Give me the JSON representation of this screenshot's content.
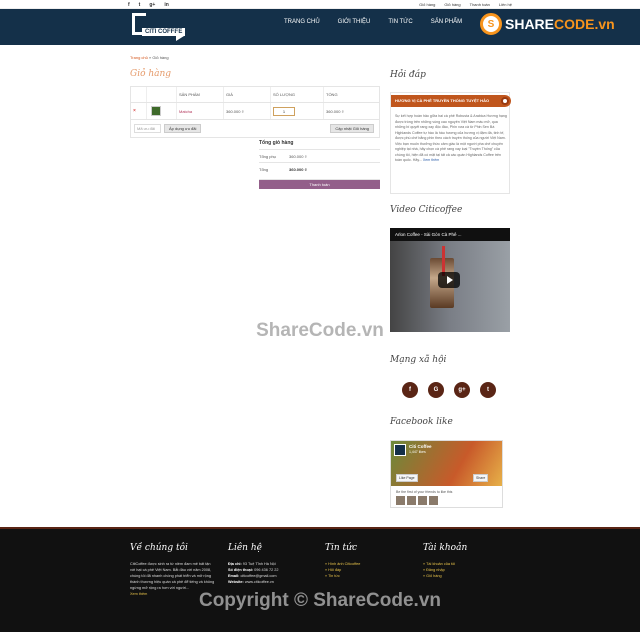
{
  "topbar": {
    "social": [
      "f",
      "t",
      "g+",
      "in"
    ],
    "links": [
      "Giỏ hàng",
      "Giỏ hàng",
      "Thanh toán",
      "Liên hệ"
    ]
  },
  "header": {
    "logo_text": "CITI COFFEE",
    "nav": [
      "TRANG CHỦ",
      "GIỚI THIỆU",
      "TIN TỨC",
      "SẢN PHẨM"
    ],
    "brand_prefix": "SHARE",
    "brand_suffix": "CODE.vn"
  },
  "breadcrumb": {
    "home": "Trang chủ",
    "sep": "»",
    "current": "Giỏ hàng"
  },
  "page_title": "Giỏ hàng",
  "cart": {
    "headers": [
      "",
      "",
      "SẢN PHẨM",
      "GIÁ",
      "SỐ LƯỢNG",
      "TỔNG"
    ],
    "rows": [
      {
        "remove": "×",
        "product": "Matcha",
        "price": "360.000 ₫",
        "qty": "1",
        "total": "360.000 ₫"
      }
    ],
    "coupon_placeholder": "Mã ưu đãi",
    "apply_label": "Áp dụng ưu đãi",
    "update_label": "Cập nhật Giỏ hàng"
  },
  "totals": {
    "title": "Tổng giỏ hàng",
    "subtotal_label": "Tổng phụ",
    "subtotal_value": "360.000 ₫",
    "total_label": "Tổng",
    "total_value": "360.000 ₫",
    "checkout_label": "Thanh toán"
  },
  "sidebar": {
    "qa_title": "Hỏi đáp",
    "news_banner": "HƯƠNG VỊ CÀ PHÊ TRUYỀN THỐNG TUYỆT HẢO",
    "news_text": "Sự kết hợp hoàn hảo giữa hai cà phê Robusta & Arabica Hương hạng được trồng trên những vùng cao nguyên Việt Nam màu mỡ, qua những bí quyết rang xay độc đáo, Phin xưa cà từ Phin Sen Bá Highlands Coffee tự hào là hầu hương của hương vị đậm đà, tinh tế, được phù chế bằng phin theo cách truyền thống của người Việt Nam. Việc bạn muốn thưởng thức cảm giác là một người pha chế chuyên nghiệp tại nhà, hãy chọn cà phê rang xay loại \"Truyền Thống\" của chúng tôi, hiện đã có mặt tại tất cả các quán Highlands Coffee trên toàn quốc. Hãy...",
    "news_more": "Xem thêm",
    "video_title": "Video Citicoffee",
    "video_caption": "Arlon Coffee - Sài Gòn Cà Phê ...",
    "social_title": "Mạng xã hội",
    "social_icons": [
      "f",
      "G",
      "g+",
      "t"
    ],
    "fb_title": "Facebook like",
    "fb_name": "Citi Coffee",
    "fb_likes": "1,447 likes",
    "fb_like_btn": "Like Page",
    "fb_share_btn": "Share",
    "fb_friends": "Be the first of your friends to like this"
  },
  "footer": {
    "about_title": "Về chúng tôi",
    "about_text": "CitiCoffee được sinh ra từ niềm đam mê bất tận với hạt cà phê Việt Nam. Bắt đầu với năm 2008, chúng tôi đã nhanh chóng phát triển và mở rộng thành thương hiệu quán cà phê để tiếng và không ngừng mở rộng ra hơn với người...",
    "about_more": "Xem thêm",
    "contact_title": "Liên hệ",
    "contact": [
      {
        "label": "Địa chỉ:",
        "value": "93 Tuệ Tĩnh Hà Nội"
      },
      {
        "label": "Số điện thoại:",
        "value": "096 436 72 22"
      },
      {
        "label": "Email:",
        "value": "citicoffee@gmail.com"
      },
      {
        "label": "Website:",
        "value": "www.citicoffee.vn"
      }
    ],
    "news_title": "Tin tức",
    "news_items": [
      "Hình ảnh Citicoffee",
      "Hỏi đáp",
      "Tin tức"
    ],
    "account_title": "Tài khoản",
    "account_items": [
      "Tài khoản của tôi",
      "Đăng nhập",
      "Giỏ hàng"
    ]
  },
  "watermark": "ShareCode.vn",
  "watermark_footer": "Copyright © ShareCode.vn"
}
